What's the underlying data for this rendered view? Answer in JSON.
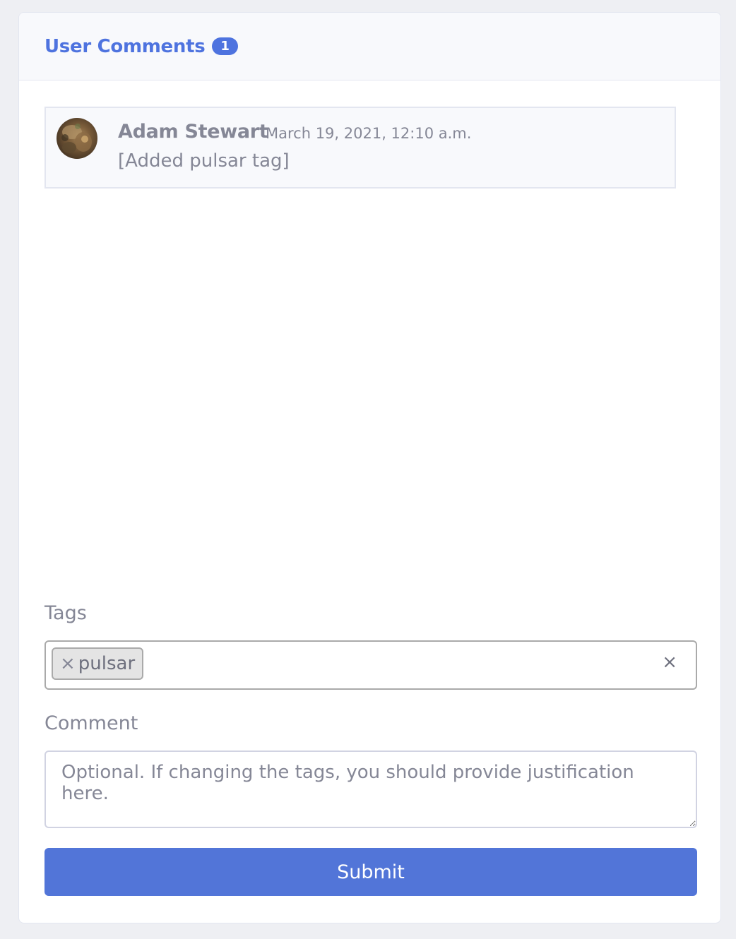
{
  "header": {
    "title": "User Comments",
    "count": "1"
  },
  "comments": [
    {
      "author": "Adam Stewart",
      "timestamp": "March 19, 2021, 12:10 a.m.",
      "text": "[Added pulsar tag]",
      "avatar_icon": "user-avatar-photo"
    }
  ],
  "form": {
    "tags_label": "Tags",
    "tags": [
      {
        "label": "pulsar",
        "remove_glyph": "×"
      }
    ],
    "clear_glyph": "×",
    "comment_label": "Comment",
    "comment_placeholder": "Optional. If changing the tags, you should provide justification here.",
    "comment_value": "",
    "submit_label": "Submit"
  },
  "colors": {
    "accent": "#4e73df",
    "button": "#5275d8",
    "muted_text": "#858796",
    "header_bg": "#f8f9fc"
  }
}
